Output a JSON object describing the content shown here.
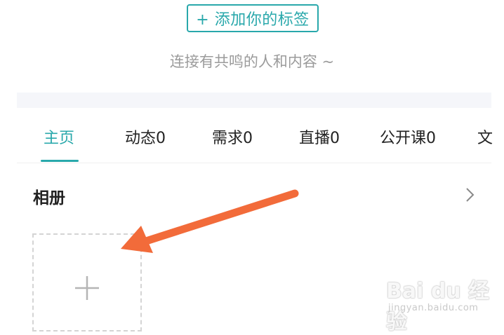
{
  "header": {
    "add_tag_label": "+ 添加你的标签",
    "tagline": "连接有共鸣的人和内容 ~"
  },
  "tabs": [
    {
      "label": "主页",
      "active": true
    },
    {
      "label": "动态0",
      "active": false
    },
    {
      "label": "需求0",
      "active": false
    },
    {
      "label": "直播0",
      "active": false
    },
    {
      "label": "公开课0",
      "active": false
    },
    {
      "label": "文",
      "active": false
    }
  ],
  "album": {
    "title": "相册"
  },
  "colors": {
    "accent": "#29a8ab",
    "arrow": "#f26b3a",
    "muted_text": "#9b9b9b"
  },
  "watermark": {
    "logo": "Bai du 经验",
    "url": "jingyan.baidu.com"
  }
}
